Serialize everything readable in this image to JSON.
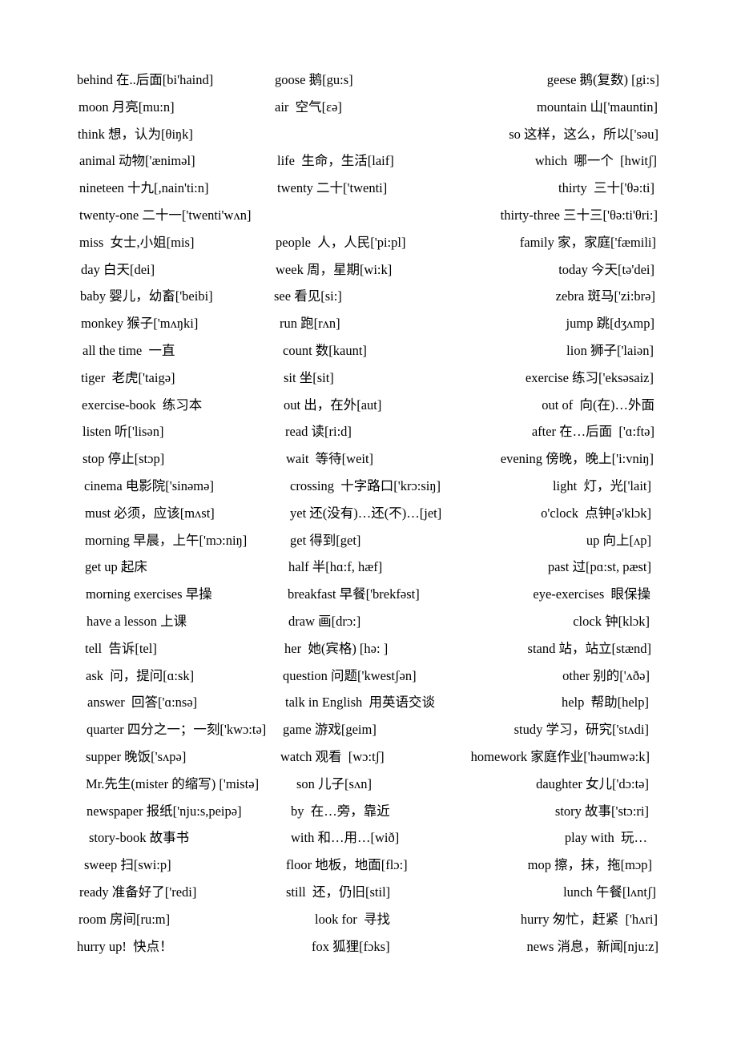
{
  "document": {
    "type": "vocabulary-list",
    "rows": [
      [
        "behind 在..后面[bi'haind]",
        "goose 鹅[gu:s]",
        "geese 鹅(复数) [gi:s]"
      ],
      [
        "moon 月亮[mu:n]",
        "air  空气[εə]",
        "mountain 山['mauntin]"
      ],
      [
        "think 想，认为[θiŋk]",
        "",
        "so 这样，这么，所以['səu]"
      ],
      [
        "animal 动物['æniməl]",
        "life  生命，生活[laif]",
        "which  哪一个  [hwitʃ]"
      ],
      [
        "nineteen 十九[,nain'ti:n]",
        "twenty 二十['twenti]",
        "thirty  三十['θə:ti]"
      ],
      [
        "twenty-one 二十一['twenti'wʌn]",
        "",
        "thirty-three 三十三['θə:ti'θri:]"
      ],
      [
        "miss  女士,小姐[mis]",
        "people  人，人民['pi:pl]",
        "family 家，家庭['fæmili]"
      ],
      [
        "day 白天[dei]",
        "week 周，星期[wi:k]",
        "today 今天[tə'dei]"
      ],
      [
        "baby 婴儿，幼畜['beibi]",
        "see 看见[si:]",
        "zebra 斑马['zi:brə]"
      ],
      [
        "monkey 猴子['mʌŋki]",
        "run 跑[rʌn]",
        "jump 跳[dʒʌmp]"
      ],
      [
        "all the time  一直",
        "count 数[kaunt]",
        "lion 狮子['laiən]"
      ],
      [
        "tiger  老虎['taigə]",
        "sit 坐[sit]",
        "exercise 练习['eksəsaiz]"
      ],
      [
        "exercise-book  练习本",
        "out 出，在外[aut]",
        "out of  向(在)…外面"
      ],
      [
        "listen 听['lisən]",
        "read 读[ri:d]",
        "after 在…后面  ['ɑ:ftə]"
      ],
      [
        "stop 停止[stɔp]",
        "wait  等待[weit]",
        "evening 傍晚，晚上['i:vniŋ]"
      ],
      [
        "cinema 电影院['sinəmə]",
        "crossing  十字路口['krɔ:siŋ]",
        "light  灯，光['lait]"
      ],
      [
        "must 必须，应该[mʌst]",
        "yet 还(没有)…还(不)…[jet]",
        "o'clock  点钟[ə'klɔk]"
      ],
      [
        "morning 早晨，上午['mɔ:niŋ]",
        "get 得到[get]",
        "up 向上[ʌp]"
      ],
      [
        "get up 起床",
        "half 半[hɑ:f, hæf]",
        "past 过[pɑ:st, pæst]"
      ],
      [
        "morning exercises 早操",
        "breakfast 早餐['brekfəst]",
        "eye-exercises  眼保操"
      ],
      [
        "have a lesson 上课",
        "draw 画[drɔ:]",
        "clock 钟[klɔk]"
      ],
      [
        "tell  告诉[tel]",
        "her  她(宾格) [hə: ]",
        "stand 站，站立[stænd]"
      ],
      [
        "ask  问，提问[ɑ:sk]",
        "question 问题['kwestʃən]",
        "other 别的['ʌðə]"
      ],
      [
        "answer  回答['ɑ:nsə]",
        "talk in English  用英语交谈",
        "help  帮助[help]"
      ],
      [
        "quarter 四分之一；一刻['kwɔ:tə]",
        "game 游戏[geim]",
        "study 学习，研究['stʌdi]"
      ],
      [
        "supper 晚饭['sʌpə]",
        "watch 观看  [wɔ:tʃ]",
        "homework 家庭作业['həumwə:k]"
      ],
      [
        "Mr.先生(mister 的缩写) ['mistə]",
        "son 儿子[sʌn]",
        "daughter 女儿['dɔ:tə]"
      ],
      [
        "newspaper 报纸['nju:s,peipə]",
        "by  在…旁，靠近",
        "story 故事['stɔ:ri]"
      ],
      [
        "story-book 故事书",
        "with 和…用…[wið]",
        "play with  玩…"
      ],
      [
        "sweep 扫[swi:p]",
        "floor 地板，地面[flɔ:]",
        "mop 擦，抹，拖[mɔp]"
      ],
      [
        "ready 准备好了['redi]",
        "still  还，仍旧[stil]",
        "lunch 午餐[lʌntʃ]"
      ],
      [
        "room 房间[ru:m]",
        "look for  寻找",
        "hurry 匆忙，赶紧  ['hʌri]"
      ],
      [
        "hurry up!  快点！",
        "fox 狐狸[fɔks]",
        "news 消息，新闻[nju:z]"
      ]
    ]
  }
}
